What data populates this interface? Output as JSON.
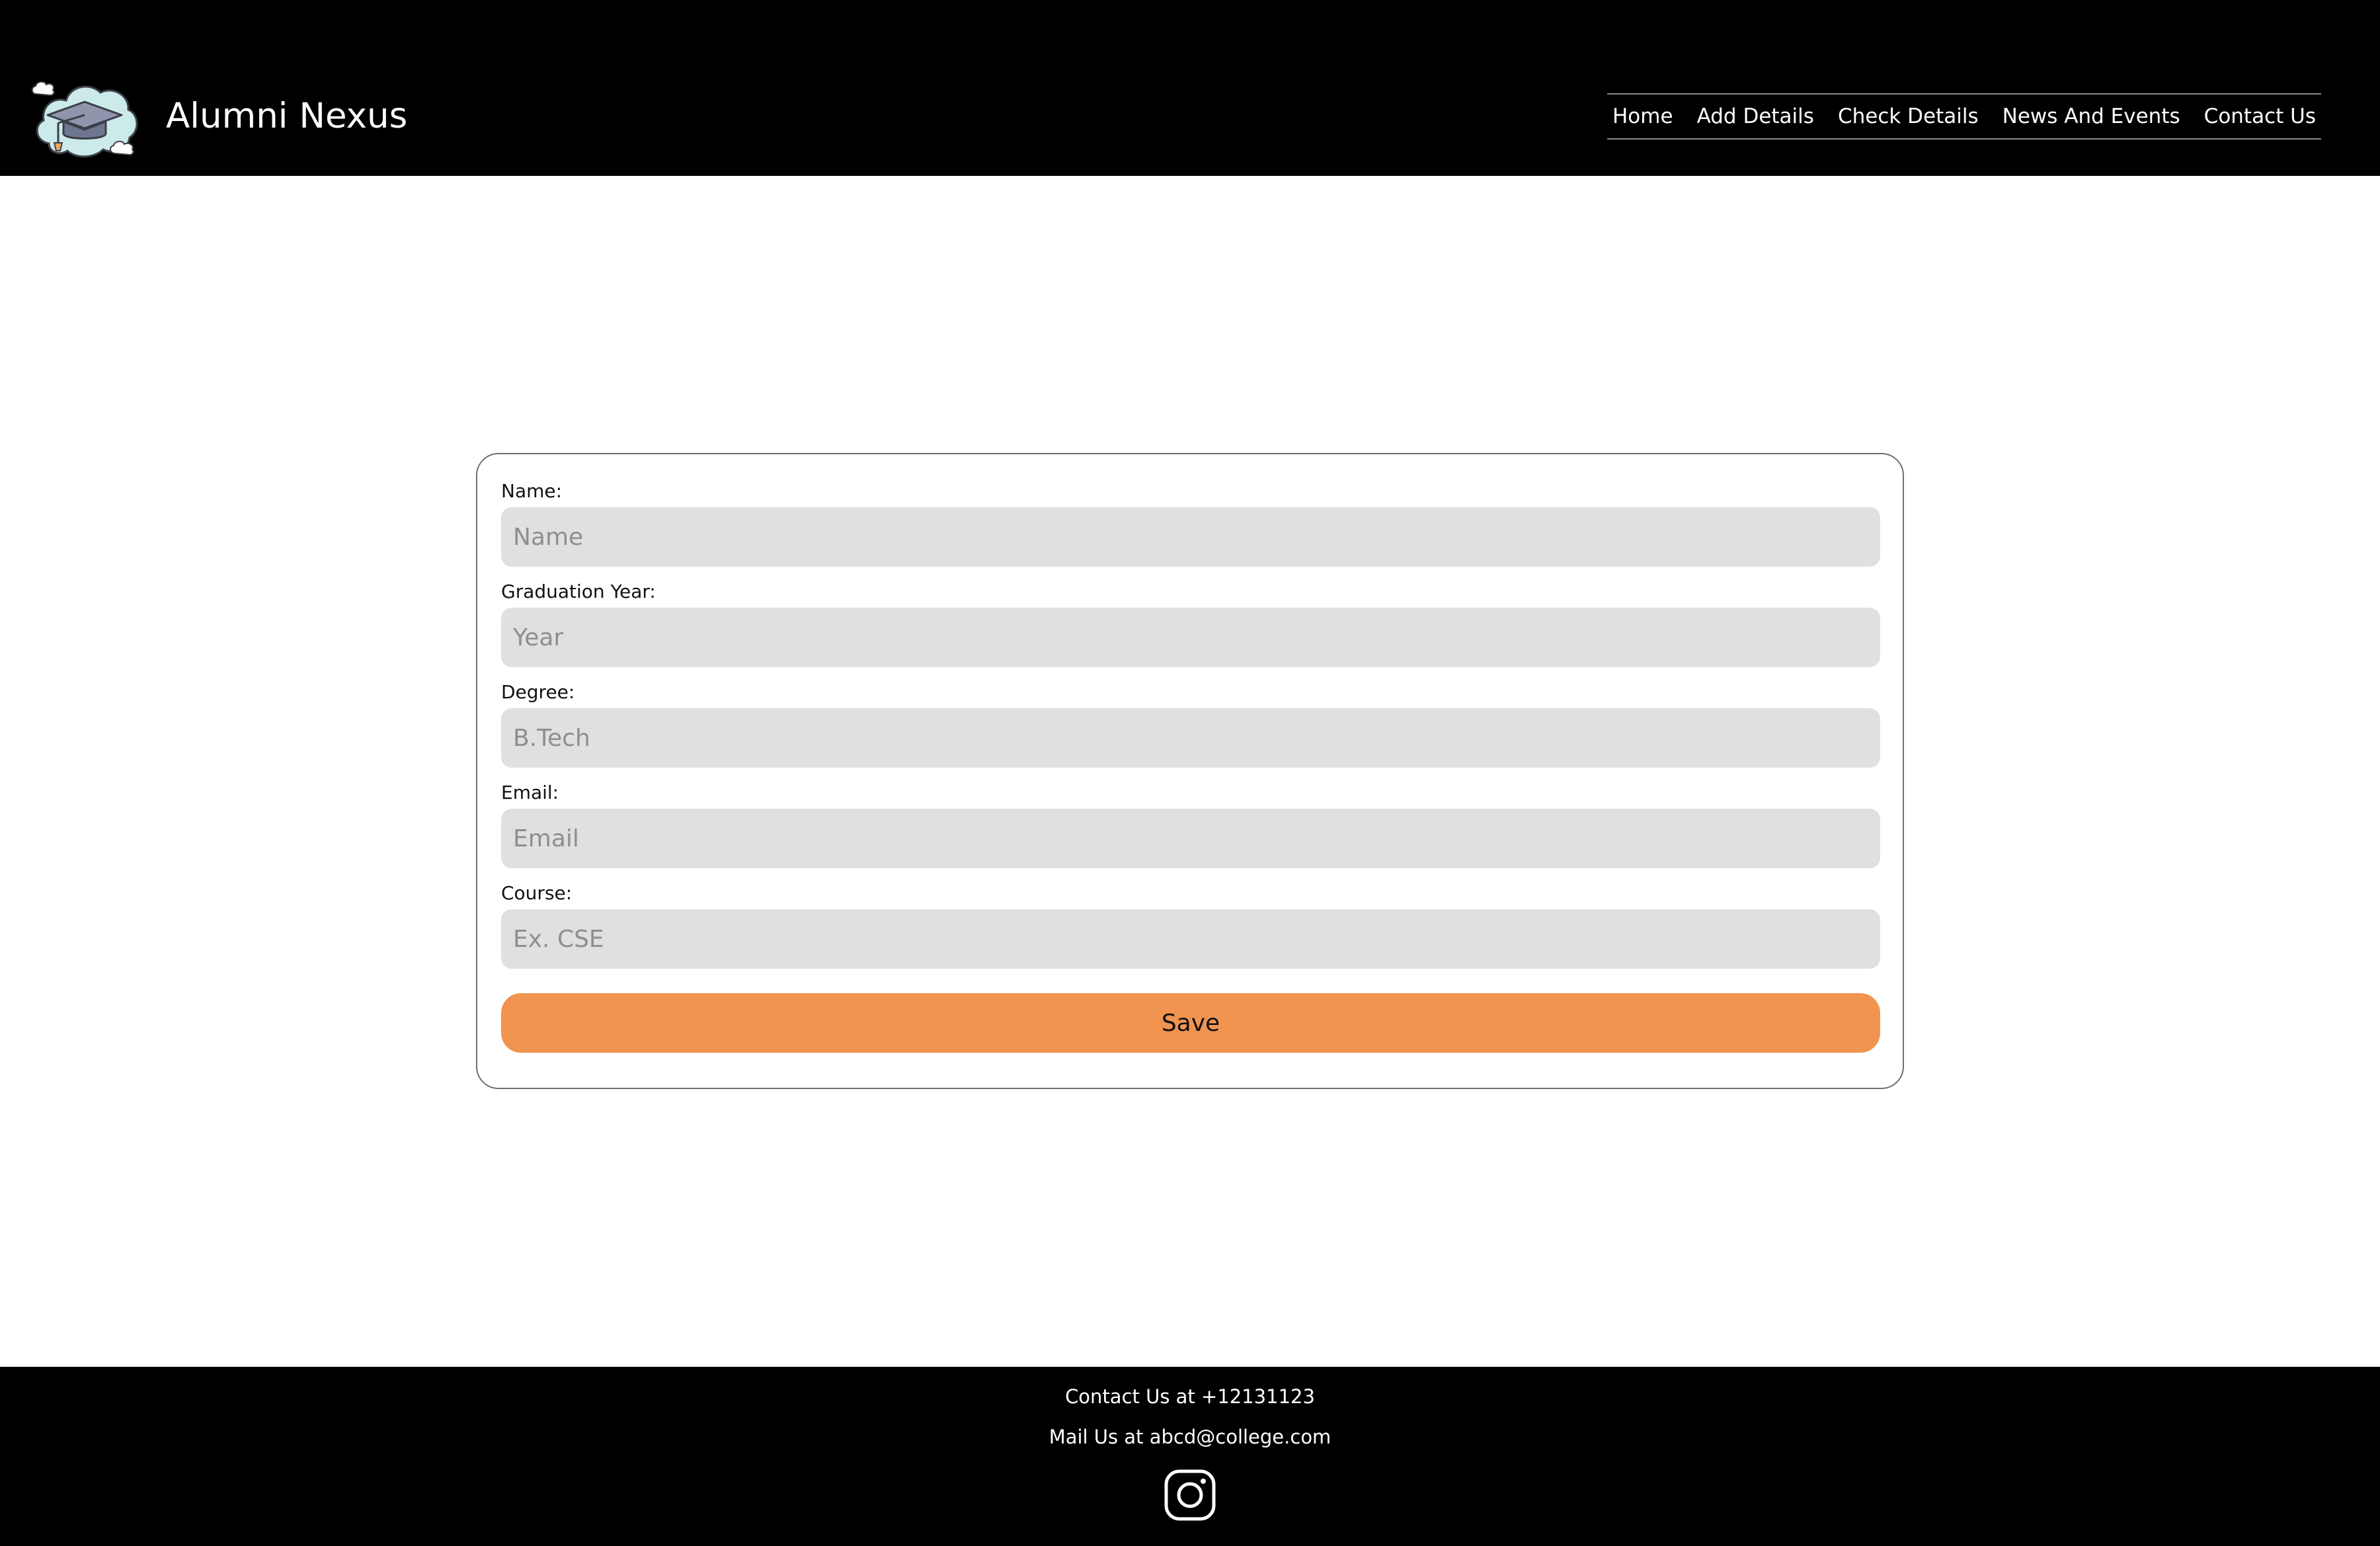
{
  "header": {
    "site_title": "Alumni Nexus",
    "logo_icon": "graduation-cap-cloud-icon",
    "nav": [
      {
        "label": "Home"
      },
      {
        "label": "Add Details"
      },
      {
        "label": "Check Details"
      },
      {
        "label": "News And Events"
      },
      {
        "label": "Contact Us"
      }
    ]
  },
  "form": {
    "fields": [
      {
        "label": "Name:",
        "placeholder": "Name",
        "value": ""
      },
      {
        "label": "Graduation Year:",
        "placeholder": "Year",
        "value": ""
      },
      {
        "label": "Degree:",
        "placeholder": "B.Tech",
        "value": ""
      },
      {
        "label": "Email:",
        "placeholder": "Email",
        "value": ""
      },
      {
        "label": "Course:",
        "placeholder": "Ex. CSE",
        "value": ""
      }
    ],
    "save_label": "Save"
  },
  "footer": {
    "contact_text": "Contact Us at +12131123",
    "mail_text": "Mail Us at abcd@college.com",
    "social_icon": "instagram-icon"
  },
  "colors": {
    "header_bg": "#000000",
    "footer_bg": "#000000",
    "input_bg": "#e0e0e0",
    "accent": "#f09450"
  }
}
